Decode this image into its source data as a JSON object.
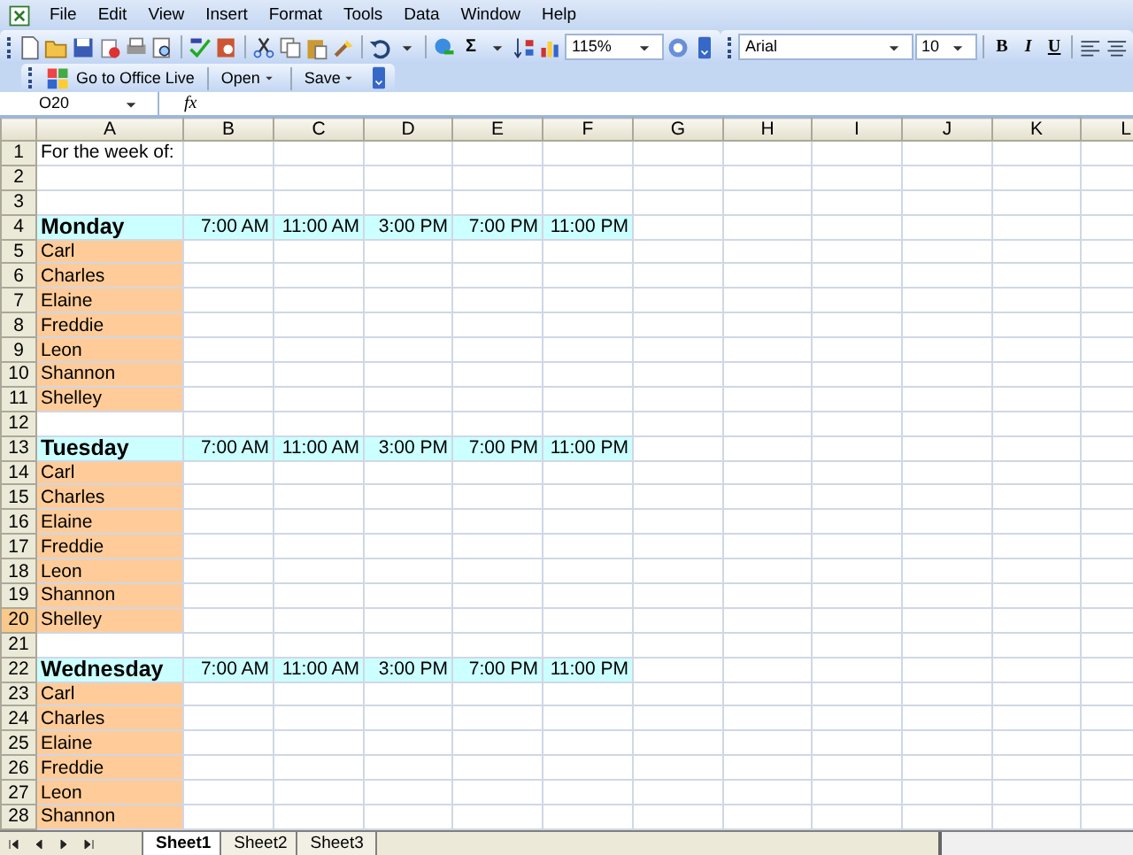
{
  "menu": [
    "File",
    "Edit",
    "View",
    "Insert",
    "Format",
    "Tools",
    "Data",
    "Window",
    "Help"
  ],
  "standard_toolbar": {
    "zoom": "115%",
    "autosum": "Σ"
  },
  "formatting_toolbar": {
    "font": "Arial",
    "size": "10",
    "bold": "B",
    "italic": "I",
    "underline": "U"
  },
  "office_live_toolbar": {
    "buttons": [
      "Go to Office Live",
      "Open",
      "Save"
    ]
  },
  "formula_bar": {
    "name_box": "O20",
    "fx": "fx"
  },
  "sheet": {
    "columns": [
      "A",
      "B",
      "C",
      "D",
      "E",
      "F",
      "G",
      "H",
      "I",
      "J",
      "K",
      "L"
    ],
    "rows": [
      {
        "number": "1",
        "selected": false,
        "kind": "plain",
        "cells": [
          "For the week of:"
        ]
      },
      {
        "number": "2",
        "selected": false,
        "kind": "plain",
        "cells": []
      },
      {
        "number": "3",
        "selected": false,
        "kind": "plain",
        "cells": []
      },
      {
        "number": "4",
        "selected": false,
        "kind": "day",
        "cells": [
          "Monday",
          "7:00 AM",
          "11:00 AM",
          "3:00 PM",
          "7:00 PM",
          "11:00 PM"
        ]
      },
      {
        "number": "5",
        "selected": false,
        "kind": "name",
        "cells": [
          "Carl"
        ]
      },
      {
        "number": "6",
        "selected": false,
        "kind": "name",
        "cells": [
          "Charles"
        ]
      },
      {
        "number": "7",
        "selected": false,
        "kind": "name",
        "cells": [
          "Elaine"
        ]
      },
      {
        "number": "8",
        "selected": false,
        "kind": "name",
        "cells": [
          "Freddie"
        ]
      },
      {
        "number": "9",
        "selected": false,
        "kind": "name",
        "cells": [
          "Leon"
        ]
      },
      {
        "number": "10",
        "selected": false,
        "kind": "name",
        "cells": [
          "Shannon"
        ]
      },
      {
        "number": "11",
        "selected": false,
        "kind": "name",
        "cells": [
          "Shelley"
        ]
      },
      {
        "number": "12",
        "selected": false,
        "kind": "plain",
        "cells": []
      },
      {
        "number": "13",
        "selected": false,
        "kind": "day",
        "cells": [
          "Tuesday",
          "7:00 AM",
          "11:00 AM",
          "3:00 PM",
          "7:00 PM",
          "11:00 PM"
        ]
      },
      {
        "number": "14",
        "selected": false,
        "kind": "name",
        "cells": [
          "Carl"
        ]
      },
      {
        "number": "15",
        "selected": false,
        "kind": "name",
        "cells": [
          "Charles"
        ]
      },
      {
        "number": "16",
        "selected": false,
        "kind": "name",
        "cells": [
          "Elaine"
        ]
      },
      {
        "number": "17",
        "selected": false,
        "kind": "name",
        "cells": [
          "Freddie"
        ]
      },
      {
        "number": "18",
        "selected": false,
        "kind": "name",
        "cells": [
          "Leon"
        ]
      },
      {
        "number": "19",
        "selected": false,
        "kind": "name",
        "cells": [
          "Shannon"
        ]
      },
      {
        "number": "20",
        "selected": true,
        "kind": "name",
        "cells": [
          "Shelley"
        ]
      },
      {
        "number": "21",
        "selected": false,
        "kind": "plain",
        "cells": []
      },
      {
        "number": "22",
        "selected": false,
        "kind": "day",
        "cells": [
          "Wednesday",
          "7:00 AM",
          "11:00 AM",
          "3:00 PM",
          "7:00 PM",
          "11:00 PM"
        ]
      },
      {
        "number": "23",
        "selected": false,
        "kind": "name",
        "cells": [
          "Carl"
        ]
      },
      {
        "number": "24",
        "selected": false,
        "kind": "name",
        "cells": [
          "Charles"
        ]
      },
      {
        "number": "25",
        "selected": false,
        "kind": "name",
        "cells": [
          "Elaine"
        ]
      },
      {
        "number": "26",
        "selected": false,
        "kind": "name",
        "cells": [
          "Freddie"
        ]
      },
      {
        "number": "27",
        "selected": false,
        "kind": "name",
        "cells": [
          "Leon"
        ]
      },
      {
        "number": "28",
        "selected": false,
        "kind": "name",
        "cells": [
          "Shannon"
        ]
      }
    ]
  },
  "sheet_tabs": [
    {
      "label": "Sheet1",
      "selected": true
    },
    {
      "label": "Sheet2",
      "selected": false
    },
    {
      "label": "Sheet3",
      "selected": false
    }
  ]
}
